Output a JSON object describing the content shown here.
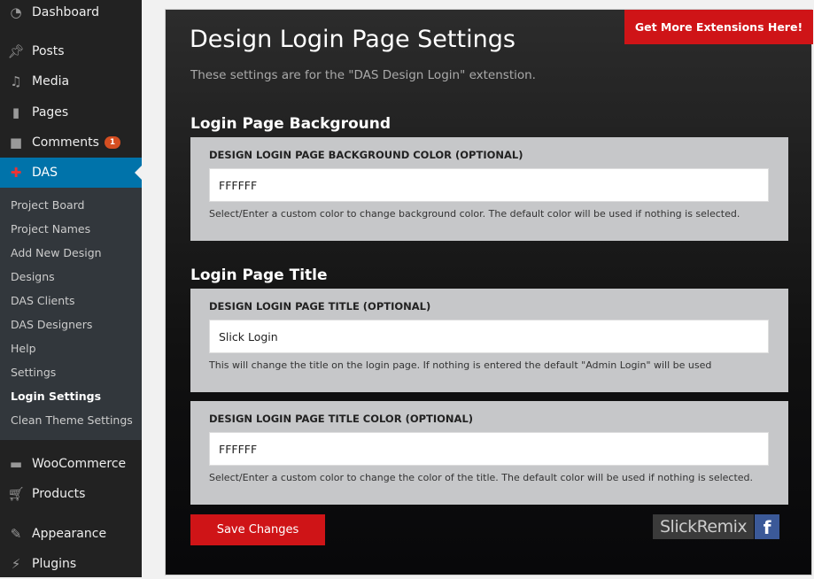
{
  "sidebar": {
    "items": [
      {
        "label": "Dashboard",
        "icon": "dashboard-icon"
      },
      {
        "label": "Posts",
        "icon": "pin-icon"
      },
      {
        "label": "Media",
        "icon": "media-icon"
      },
      {
        "label": "Pages",
        "icon": "pages-icon"
      },
      {
        "label": "Comments",
        "icon": "comment-icon",
        "badge": "1"
      },
      {
        "label": "DAS",
        "icon": "das-icon"
      },
      {
        "label": "WooCommerce",
        "icon": "woo-icon"
      },
      {
        "label": "Products",
        "icon": "cart-icon"
      },
      {
        "label": "Appearance",
        "icon": "brush-icon"
      },
      {
        "label": "Plugins",
        "icon": "plug-icon"
      }
    ],
    "submenu": [
      "Project Board",
      "Project Names",
      "Add New Design",
      "Designs",
      "DAS Clients",
      "DAS Designers",
      "Help",
      "Settings",
      "Login Settings",
      "Clean Theme Settings"
    ]
  },
  "main": {
    "extensions_button": "Get More Extensions Here!",
    "title": "Design Login Page Settings",
    "subtitle": "These settings are for the \"DAS Design Login\" extenstion.",
    "sections": [
      {
        "title": "Login Page Background"
      },
      {
        "title": "Login Page Title"
      }
    ],
    "fields": [
      {
        "label": "DESIGN LOGIN PAGE BACKGROUND COLOR (OPTIONAL)",
        "value": "FFFFFF",
        "desc": "Select/Enter a custom color to change background color. The default color will be used if nothing is selected."
      },
      {
        "label": "DESIGN LOGIN PAGE TITLE (OPTIONAL)",
        "value": "Slick Login",
        "desc": "This will change the title on the login page. If nothing is entered the default \"Admin Login\" will be used"
      },
      {
        "label": "DESIGN LOGIN PAGE TITLE COLOR (OPTIONAL)",
        "value": "FFFFFF",
        "desc": "Select/Enter a custom color to change the color of the title. The default color will be used if nothing is selected."
      }
    ],
    "save": "Save Changes",
    "logo": "SlickRemix",
    "fb": "f"
  },
  "colors": {
    "accent": "#cf1417",
    "wp_active": "#0073aa"
  }
}
